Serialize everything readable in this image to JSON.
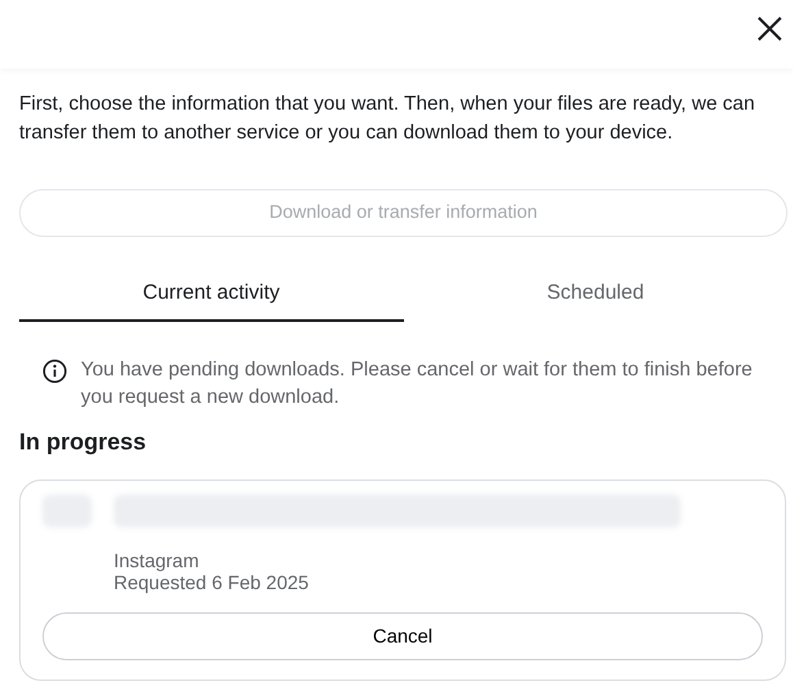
{
  "intro": "First, choose the information that you want. Then, when your files are ready, we can transfer them to another service or you can download them to your device.",
  "main_button": {
    "label": "Download or transfer information",
    "disabled": true
  },
  "tabs": [
    {
      "label": "Current activity",
      "selected": true
    },
    {
      "label": "Scheduled",
      "selected": false
    }
  ],
  "notice": "You have pending downloads. Please cancel or wait for them to finish before you request a new download.",
  "section_title": "In progress",
  "requests": [
    {
      "app": "Instagram",
      "date": "Requested 6 Feb 2025",
      "button": "Cancel"
    }
  ]
}
